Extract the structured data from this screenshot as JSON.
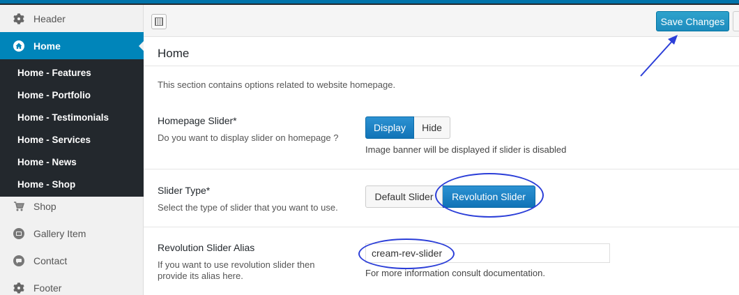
{
  "sidebar": {
    "items_top": [
      {
        "label": "Header",
        "icon": "gear-icon"
      },
      {
        "label": "Home",
        "icon": "home-icon",
        "active": true
      }
    ],
    "submenu": [
      "Home - Features",
      "Home - Portfolio",
      "Home - Testimonials",
      "Home - Services",
      "Home - News",
      "Home - Shop"
    ],
    "items_bottom": [
      {
        "label": "Shop",
        "icon": "cart-icon"
      },
      {
        "label": "Gallery Item",
        "icon": "gallery-icon"
      },
      {
        "label": "Contact",
        "icon": "chat-icon"
      },
      {
        "label": "Footer",
        "icon": "gear-icon"
      }
    ]
  },
  "toolbar": {
    "save_label": "Save Changes"
  },
  "section": {
    "title": "Home",
    "description": "This section contains options related to website homepage."
  },
  "options": {
    "slider": {
      "title": "Homepage Slider*",
      "desc": "Do you want to display slider on homepage ?",
      "buttons": [
        "Display",
        "Hide"
      ],
      "selected": "Display",
      "help": "Image banner will be displayed if slider is disabled"
    },
    "slider_type": {
      "title": "Slider Type*",
      "desc": "Select the type of slider that you want to use.",
      "buttons": [
        "Default Slider",
        "Revolution Slider"
      ],
      "selected": "Revolution Slider"
    },
    "alias": {
      "title": "Revolution Slider Alias",
      "desc_line1": "If you want to use revolution slider then",
      "desc_line2": "provide its alias here.",
      "value": "cream-rev-slider",
      "help": "For more information consult documentation."
    }
  },
  "colors": {
    "accent": "#0085ba",
    "annotation": "#2b3ed8",
    "sidebar_submenu_bg": "#23282d"
  }
}
